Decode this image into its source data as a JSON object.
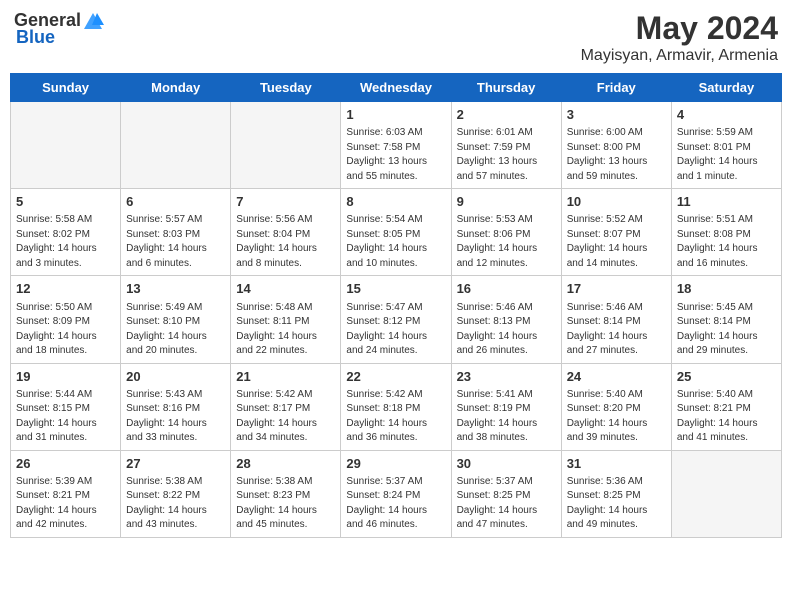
{
  "header": {
    "logo_general": "General",
    "logo_blue": "Blue",
    "month": "May 2024",
    "location": "Mayisyan, Armavir, Armenia"
  },
  "weekdays": [
    "Sunday",
    "Monday",
    "Tuesday",
    "Wednesday",
    "Thursday",
    "Friday",
    "Saturday"
  ],
  "weeks": [
    [
      {
        "day": "",
        "info": ""
      },
      {
        "day": "",
        "info": ""
      },
      {
        "day": "",
        "info": ""
      },
      {
        "day": "1",
        "info": "Sunrise: 6:03 AM\nSunset: 7:58 PM\nDaylight: 13 hours\nand 55 minutes."
      },
      {
        "day": "2",
        "info": "Sunrise: 6:01 AM\nSunset: 7:59 PM\nDaylight: 13 hours\nand 57 minutes."
      },
      {
        "day": "3",
        "info": "Sunrise: 6:00 AM\nSunset: 8:00 PM\nDaylight: 13 hours\nand 59 minutes."
      },
      {
        "day": "4",
        "info": "Sunrise: 5:59 AM\nSunset: 8:01 PM\nDaylight: 14 hours\nand 1 minute."
      }
    ],
    [
      {
        "day": "5",
        "info": "Sunrise: 5:58 AM\nSunset: 8:02 PM\nDaylight: 14 hours\nand 3 minutes."
      },
      {
        "day": "6",
        "info": "Sunrise: 5:57 AM\nSunset: 8:03 PM\nDaylight: 14 hours\nand 6 minutes."
      },
      {
        "day": "7",
        "info": "Sunrise: 5:56 AM\nSunset: 8:04 PM\nDaylight: 14 hours\nand 8 minutes."
      },
      {
        "day": "8",
        "info": "Sunrise: 5:54 AM\nSunset: 8:05 PM\nDaylight: 14 hours\nand 10 minutes."
      },
      {
        "day": "9",
        "info": "Sunrise: 5:53 AM\nSunset: 8:06 PM\nDaylight: 14 hours\nand 12 minutes."
      },
      {
        "day": "10",
        "info": "Sunrise: 5:52 AM\nSunset: 8:07 PM\nDaylight: 14 hours\nand 14 minutes."
      },
      {
        "day": "11",
        "info": "Sunrise: 5:51 AM\nSunset: 8:08 PM\nDaylight: 14 hours\nand 16 minutes."
      }
    ],
    [
      {
        "day": "12",
        "info": "Sunrise: 5:50 AM\nSunset: 8:09 PM\nDaylight: 14 hours\nand 18 minutes."
      },
      {
        "day": "13",
        "info": "Sunrise: 5:49 AM\nSunset: 8:10 PM\nDaylight: 14 hours\nand 20 minutes."
      },
      {
        "day": "14",
        "info": "Sunrise: 5:48 AM\nSunset: 8:11 PM\nDaylight: 14 hours\nand 22 minutes."
      },
      {
        "day": "15",
        "info": "Sunrise: 5:47 AM\nSunset: 8:12 PM\nDaylight: 14 hours\nand 24 minutes."
      },
      {
        "day": "16",
        "info": "Sunrise: 5:46 AM\nSunset: 8:13 PM\nDaylight: 14 hours\nand 26 minutes."
      },
      {
        "day": "17",
        "info": "Sunrise: 5:46 AM\nSunset: 8:14 PM\nDaylight: 14 hours\nand 27 minutes."
      },
      {
        "day": "18",
        "info": "Sunrise: 5:45 AM\nSunset: 8:14 PM\nDaylight: 14 hours\nand 29 minutes."
      }
    ],
    [
      {
        "day": "19",
        "info": "Sunrise: 5:44 AM\nSunset: 8:15 PM\nDaylight: 14 hours\nand 31 minutes."
      },
      {
        "day": "20",
        "info": "Sunrise: 5:43 AM\nSunset: 8:16 PM\nDaylight: 14 hours\nand 33 minutes."
      },
      {
        "day": "21",
        "info": "Sunrise: 5:42 AM\nSunset: 8:17 PM\nDaylight: 14 hours\nand 34 minutes."
      },
      {
        "day": "22",
        "info": "Sunrise: 5:42 AM\nSunset: 8:18 PM\nDaylight: 14 hours\nand 36 minutes."
      },
      {
        "day": "23",
        "info": "Sunrise: 5:41 AM\nSunset: 8:19 PM\nDaylight: 14 hours\nand 38 minutes."
      },
      {
        "day": "24",
        "info": "Sunrise: 5:40 AM\nSunset: 8:20 PM\nDaylight: 14 hours\nand 39 minutes."
      },
      {
        "day": "25",
        "info": "Sunrise: 5:40 AM\nSunset: 8:21 PM\nDaylight: 14 hours\nand 41 minutes."
      }
    ],
    [
      {
        "day": "26",
        "info": "Sunrise: 5:39 AM\nSunset: 8:21 PM\nDaylight: 14 hours\nand 42 minutes."
      },
      {
        "day": "27",
        "info": "Sunrise: 5:38 AM\nSunset: 8:22 PM\nDaylight: 14 hours\nand 43 minutes."
      },
      {
        "day": "28",
        "info": "Sunrise: 5:38 AM\nSunset: 8:23 PM\nDaylight: 14 hours\nand 45 minutes."
      },
      {
        "day": "29",
        "info": "Sunrise: 5:37 AM\nSunset: 8:24 PM\nDaylight: 14 hours\nand 46 minutes."
      },
      {
        "day": "30",
        "info": "Sunrise: 5:37 AM\nSunset: 8:25 PM\nDaylight: 14 hours\nand 47 minutes."
      },
      {
        "day": "31",
        "info": "Sunrise: 5:36 AM\nSunset: 8:25 PM\nDaylight: 14 hours\nand 49 minutes."
      },
      {
        "day": "",
        "info": ""
      }
    ]
  ]
}
